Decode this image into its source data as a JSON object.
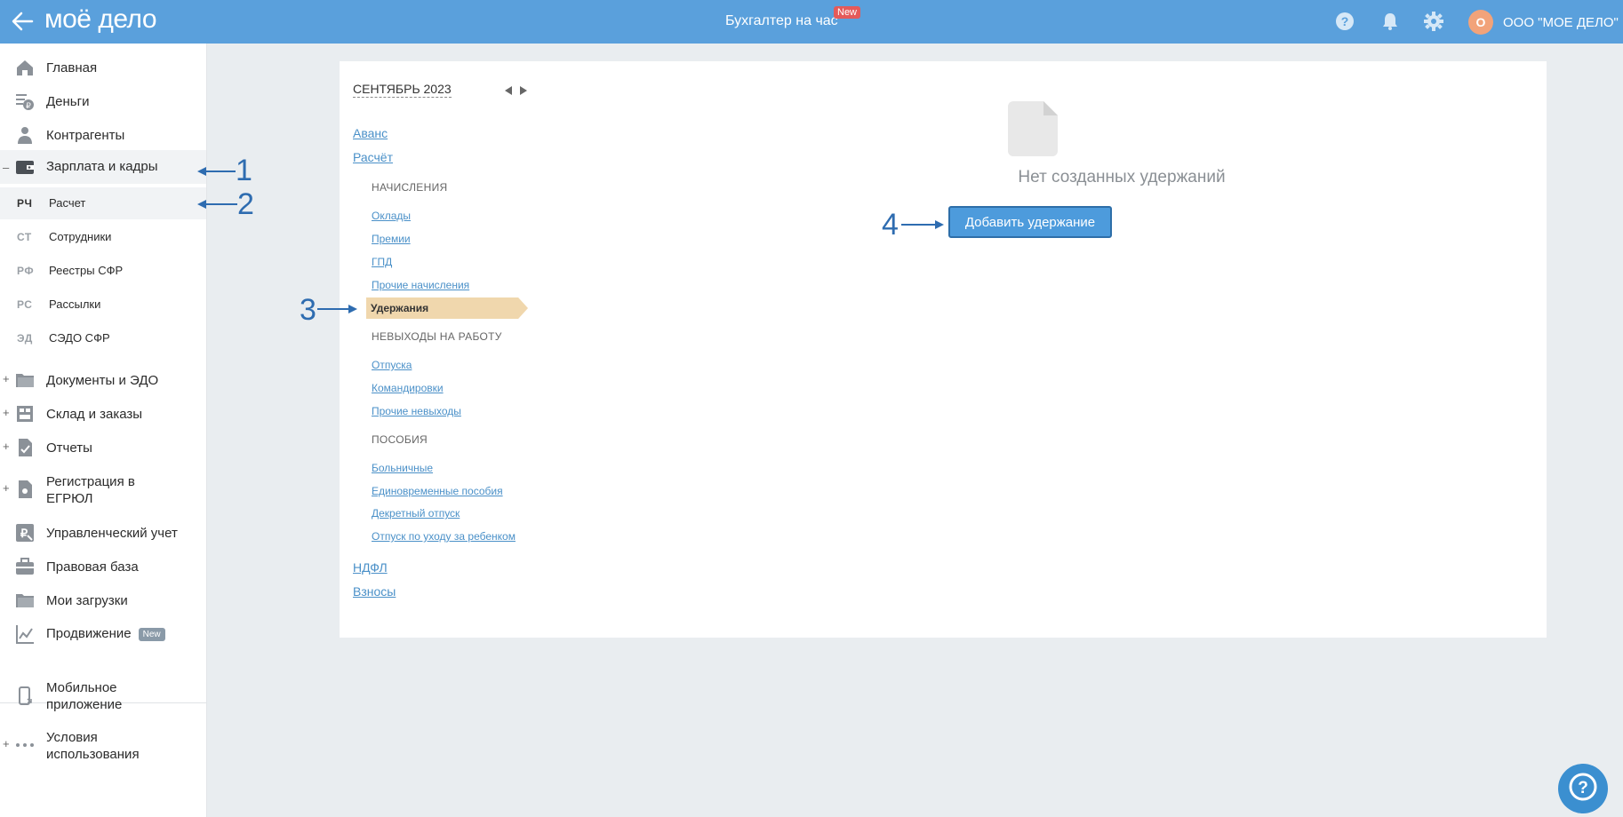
{
  "topbar": {
    "logo": "моё дело",
    "center_link": "Бухгалтер на час",
    "center_badge": "New",
    "avatar_letter": "О",
    "company": "ООО \"МОЕ ДЕЛО\""
  },
  "sidebar": {
    "items": [
      {
        "label": "Главная"
      },
      {
        "label": "Деньги"
      },
      {
        "label": "Контрагенты"
      },
      {
        "label": "Зарплата и кадры"
      }
    ],
    "subitems": [
      {
        "abbr": "РЧ",
        "label": "Расчет"
      },
      {
        "abbr": "СТ",
        "label": "Сотрудники"
      },
      {
        "abbr": "РФ",
        "label": "Реестры СФР"
      },
      {
        "abbr": "РС",
        "label": "Рассылки"
      },
      {
        "abbr": "ЭД",
        "label": "СЭДО СФР"
      }
    ],
    "items2": [
      {
        "label": "Документы и ЭДО"
      },
      {
        "label": "Склад и заказы"
      },
      {
        "label": "Отчеты"
      },
      {
        "label": "Регистрация в ЕГРЮЛ"
      },
      {
        "label": "Управленческий учет"
      },
      {
        "label": "Правовая база"
      },
      {
        "label": "Мои загрузки"
      },
      {
        "label": "Продвижение",
        "badge": "New"
      }
    ],
    "bottom": [
      {
        "label": "Мобильное приложение"
      },
      {
        "label": "Условия использования"
      }
    ]
  },
  "main": {
    "month": "СЕНТЯБРЬ 2023",
    "links_top": [
      "Аванс",
      "Расчёт"
    ],
    "section_accruals": "НАЧИСЛЕНИЯ",
    "accruals": [
      "Оклады",
      "Премии",
      "ГПД",
      "Прочие начисления"
    ],
    "active": "Удержания",
    "section_absences": "НЕВЫХОДЫ НА РАБОТУ",
    "absences": [
      "Отпуска",
      "Командировки",
      "Прочие невыходы"
    ],
    "section_benefits": "ПОСОБИЯ",
    "benefits": [
      "Больничные",
      "Единовременные пособия",
      "Декретный отпуск",
      "Отпуск по уходу за ребенком"
    ],
    "links_bottom": [
      "НДФЛ",
      "Взносы"
    ],
    "empty_text": "Нет созданных удержаний",
    "add_button": "Добавить удержание"
  },
  "annotations": [
    "1",
    "2",
    "3",
    "4"
  ],
  "colors": {
    "topbar": "#5aa0dc",
    "accent": "#4d9bdc",
    "active_item": "#f0d7ad",
    "annotation": "#2e6cb0"
  }
}
